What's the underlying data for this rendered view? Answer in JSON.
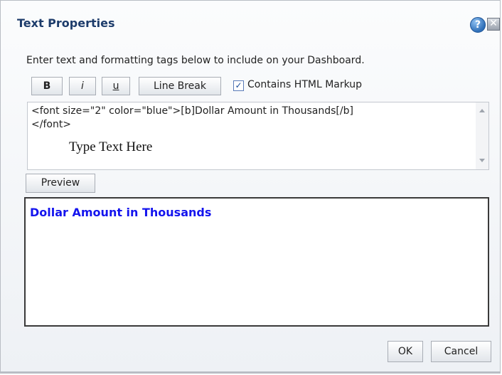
{
  "dialog": {
    "title": "Text Properties",
    "help_icon": "?",
    "close_icon": "✕"
  },
  "instructions": "Enter text and formatting tags below to include on your Dashboard.",
  "toolbar": {
    "bold_label": "B",
    "italic_label": "i",
    "underline_label": "u",
    "line_break_label": "Line Break",
    "checkbox_label": "Contains HTML Markup",
    "checkbox_checked": true,
    "checkmark": "✓"
  },
  "editor": {
    "line1": "<font size=\"2\" color=\"blue\">[b]Dollar Amount in Thousands[/b]",
    "line2": "</font>",
    "placeholder": "Type Text Here"
  },
  "preview": {
    "button_label": "Preview",
    "rendered_text": "Dollar Amount in Thousands",
    "rendered_color": "#1414ee"
  },
  "footer": {
    "ok_label": "OK",
    "cancel_label": "Cancel"
  }
}
